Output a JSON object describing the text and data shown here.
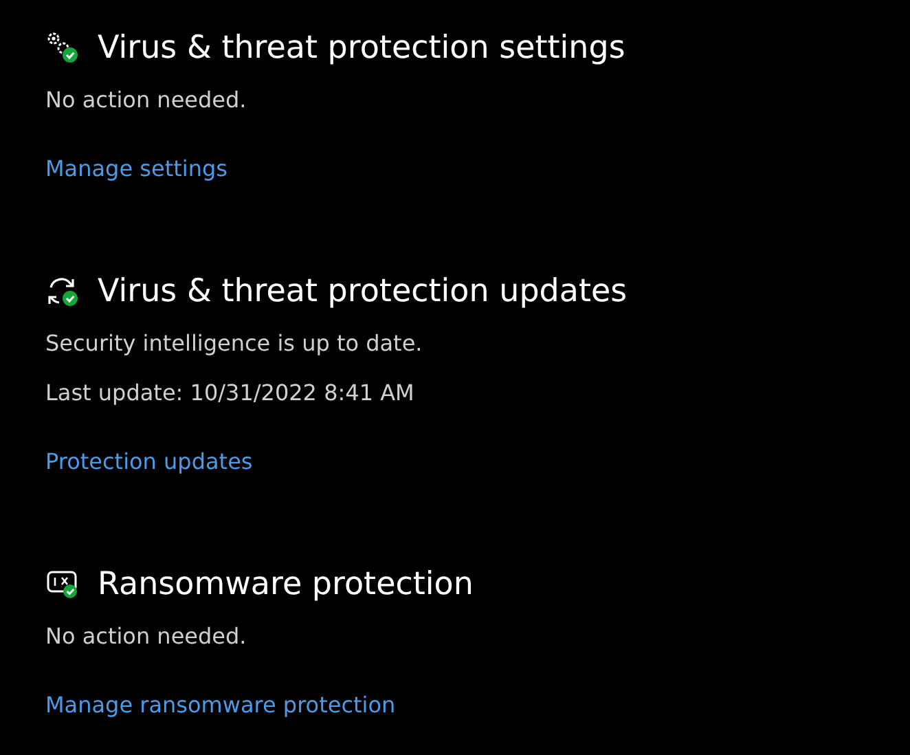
{
  "sections": [
    {
      "kind": "settings",
      "title": "Virus & threat protection settings",
      "lines": [
        "No action needed."
      ],
      "link": "Manage settings"
    },
    {
      "kind": "updates",
      "title": "Virus & threat protection updates",
      "lines": [
        "Security intelligence is up to date.",
        "Last update: 10/31/2022 8:41 AM"
      ],
      "link": "Protection updates"
    },
    {
      "kind": "ransomware",
      "title": "Ransomware protection",
      "lines": [
        "No action needed."
      ],
      "link": "Manage ransomware protection"
    }
  ]
}
